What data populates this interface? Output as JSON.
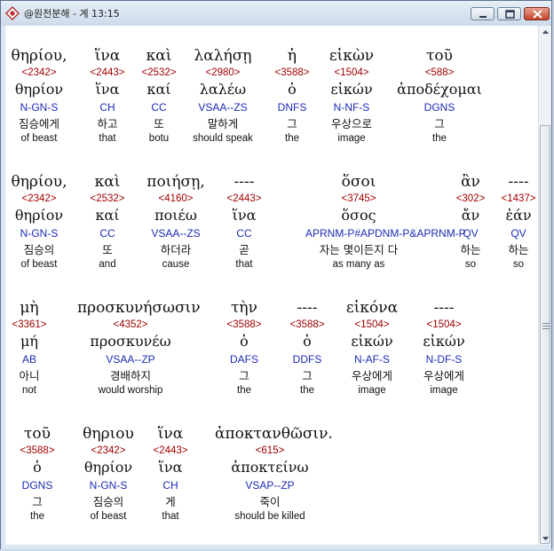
{
  "window": {
    "title": "@원전분해 - 계 13:15"
  },
  "rows": [
    {
      "words": [
        {
          "gr": "θηρίου,",
          "num": "<2342>",
          "lem": "θηρίον",
          "pos": "N-GN-S",
          "ko": "짐승에게",
          "en": "of beast"
        },
        {
          "gr": "ἵνα",
          "num": "<2443>",
          "lem": "ἵνα",
          "pos": "CH",
          "ko": "하고",
          "en": "that"
        },
        {
          "gr": "καὶ",
          "num": "<2532>",
          "lem": "καί",
          "pos": "CC",
          "ko": "또",
          "en": "botu"
        },
        {
          "gr": "λαλήσῃ",
          "num": "<2980>",
          "lem": "λαλέω",
          "pos": "VSAA--ZS",
          "ko": "말하게",
          "en": "should speak"
        },
        {
          "gr": "ἡ",
          "num": "<3588>",
          "lem": "ὁ",
          "pos": "DNFS",
          "ko": "그",
          "en": "the"
        },
        {
          "gr": "εἰκὼν",
          "num": "<1504>",
          "lem": "εἰκών",
          "pos": "N-NF-S",
          "ko": "우상으로",
          "en": "image"
        },
        {
          "gr": "τοῦ",
          "num": "<588>",
          "lem": "ἀποδέχομαι",
          "pos": "DGNS",
          "ko": "그",
          "en": "the"
        }
      ]
    },
    {
      "words": [
        {
          "gr": "θηρίου,",
          "num": "<2342>",
          "lem": "θηρίον",
          "pos": "N-GN-S",
          "ko": "짐승의",
          "en": "of beast"
        },
        {
          "gr": "καὶ",
          "num": "<2532>",
          "lem": "καί",
          "pos": "CC",
          "ko": "또",
          "en": "and"
        },
        {
          "gr": "ποιήσῃ,",
          "num": "<4160>",
          "lem": "ποιέω",
          "pos": "VSAA--ZS",
          "ko": "하더라",
          "en": "cause"
        },
        {
          "gr": "----",
          "num": "<2443>",
          "lem": "ἵνα",
          "pos": "CC",
          "ko": "곧",
          "en": "that"
        },
        {
          "gr": "ὅσοι",
          "num": "<3745>",
          "lem": "ὅσος",
          "pos": "APRNM-P#APDNM-P&APRNM-P",
          "ko": "자는 몇이든지 다",
          "en": "as many as"
        },
        {
          "gr": "ἂν",
          "num": "<302>",
          "lem": "ἄν",
          "pos": "QV",
          "ko": "하는",
          "en": "so"
        },
        {
          "gr": "----",
          "num": "<1437>",
          "lem": "ἐάν",
          "pos": "QV",
          "ko": "하는",
          "en": "so"
        }
      ]
    },
    {
      "words": [
        {
          "gr": "μὴ",
          "num": "<3361>",
          "lem": "μή",
          "pos": "AB",
          "ko": "아니",
          "en": "not"
        },
        {
          "gr": "προσκυνήσωσιν",
          "num": "<4352>",
          "lem": "προσκυνέω",
          "pos": "VSAA--ZP",
          "ko": "경배하지",
          "en": "would worship"
        },
        {
          "gr": "τὴν",
          "num": "<3588>",
          "lem": "ὁ",
          "pos": "DAFS",
          "ko": "그",
          "en": "the"
        },
        {
          "gr": "----",
          "num": "<3588>",
          "lem": "ὁ",
          "pos": "DDFS",
          "ko": "그",
          "en": "the"
        },
        {
          "gr": "εἰκόνα",
          "num": "<1504>",
          "lem": "εἰκών",
          "pos": "N-AF-S",
          "ko": "우상에게",
          "en": "image"
        },
        {
          "gr": "----",
          "num": "<1504>",
          "lem": "εἰκών",
          "pos": "N-DF-S",
          "ko": "우상에게",
          "en": "image"
        }
      ]
    },
    {
      "words": [
        {
          "gr": "τοῦ",
          "num": "<3588>",
          "lem": "ὁ",
          "pos": "DGNS",
          "ko": "그",
          "en": "the"
        },
        {
          "gr": "θηριου",
          "num": "<2342>",
          "lem": "θηρίον",
          "pos": "N-GN-S",
          "ko": "짐승의",
          "en": "of beast"
        },
        {
          "gr": "ἵνα",
          "num": "<2443>",
          "lem": "ἵνα",
          "pos": "CH",
          "ko": "게",
          "en": "that"
        },
        {
          "gr": "ἀποκτανθῶσιν.",
          "num": "<615>",
          "lem": "ἀποκτείνω",
          "pos": "VSAP--ZP",
          "ko": "죽이",
          "en": "should be killed"
        }
      ]
    }
  ]
}
